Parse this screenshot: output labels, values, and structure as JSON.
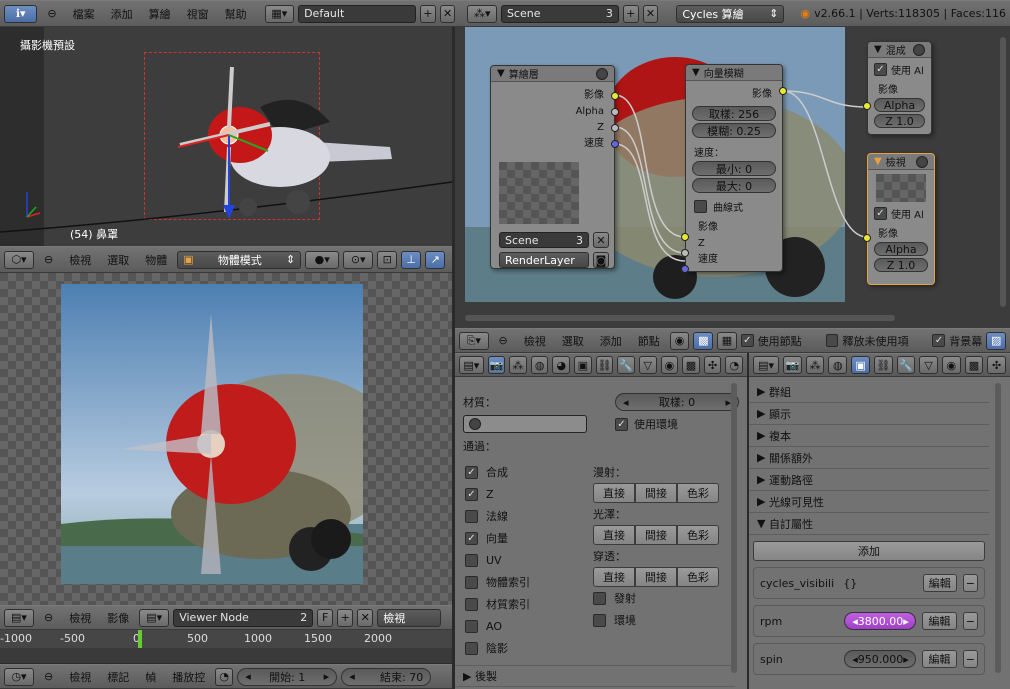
{
  "info_header": {
    "menus": [
      "檔案",
      "添加",
      "算繪",
      "視窗",
      "幫助"
    ],
    "screen_layout": "Default",
    "scene": "Scene",
    "scene_users": "3",
    "render_engine": "Cycles 算繪",
    "stats": "v2.66.1 | Verts:118305 | Faces:116"
  },
  "viewport3d": {
    "title": "攝影機預設",
    "object_label": "(54) 鼻罩",
    "menus": [
      "檢視",
      "選取",
      "物體"
    ],
    "mode": "物體模式"
  },
  "image_editor": {
    "menus": [
      "檢視",
      "影像"
    ],
    "image": "Viewer Node",
    "users": "2",
    "fake": "F",
    "view_label": "檢視"
  },
  "timeline": {
    "ticks": [
      "-1000",
      "-500",
      "0",
      "500",
      "1000",
      "1500",
      "2000"
    ],
    "menus": [
      "檢視",
      "標記",
      "幀",
      "播放控"
    ],
    "start": "開始: 1",
    "end": "結束: 70"
  },
  "node_editor": {
    "render_layers": {
      "title": "算繪層",
      "outputs": [
        "影像",
        "Alpha",
        "Z",
        "速度"
      ],
      "scene": "Scene",
      "scene_users": "3",
      "layer": "RenderLayer"
    },
    "vector_blur": {
      "title": "向量模糊",
      "output": "影像",
      "samples": "取樣: 256",
      "blur": "模糊: 0.25",
      "speed_label": "速度：",
      "min": "最小: 0",
      "max": "最大: 0",
      "curved": "曲線式",
      "inputs": [
        "影像",
        "Z",
        "速度"
      ]
    },
    "mix": {
      "title": "混成",
      "use_alpha": "使用 Al",
      "input_image": "影像",
      "alpha": "Alpha",
      "z": "Z 1.0"
    },
    "viewer": {
      "title": "檢視",
      "use_alpha": "使用 Al",
      "input_image": "影像",
      "alpha": "Alpha",
      "z": "Z 1.0"
    },
    "menus": [
      "檢視",
      "選取",
      "添加",
      "節點"
    ],
    "use_nodes": "使用節點",
    "free_unused": "釋放未使用項",
    "backdrop": "背景幕"
  },
  "props_left": {
    "material_label": "材質：",
    "samples": "取樣: 0",
    "use_env": "使用環境",
    "passes_label": "通過：",
    "passes": [
      {
        "label": "合成",
        "on": true
      },
      {
        "label": "Z",
        "on": true
      },
      {
        "label": "法線",
        "on": false
      },
      {
        "label": "向量",
        "on": true
      },
      {
        "label": "UV",
        "on": false
      },
      {
        "label": "物體索引",
        "on": false
      },
      {
        "label": "材質索引",
        "on": false
      },
      {
        "label": "AO",
        "on": false
      },
      {
        "label": "陰影",
        "on": false
      }
    ],
    "diffuse_label": "漫射：",
    "glossy_label": "光澤：",
    "trans_label": "穿透：",
    "direct": "直接",
    "indirect": "間接",
    "color": "色彩",
    "emit": "發射",
    "env": "環境",
    "post": "後製"
  },
  "props_right": {
    "sections": [
      "群組",
      "顯示",
      "複本",
      "關係額外",
      "運動路徑",
      "光線可見性"
    ],
    "custom_section": "自訂屬性",
    "add_btn": "添加",
    "props": [
      {
        "name": "cycles_visibili",
        "value": "{}",
        "edit": "編輯"
      },
      {
        "name": "rpm",
        "value": "3800.00",
        "edit": "編輯"
      },
      {
        "name": "spin",
        "value": "950.000",
        "edit": "編輯"
      }
    ]
  }
}
